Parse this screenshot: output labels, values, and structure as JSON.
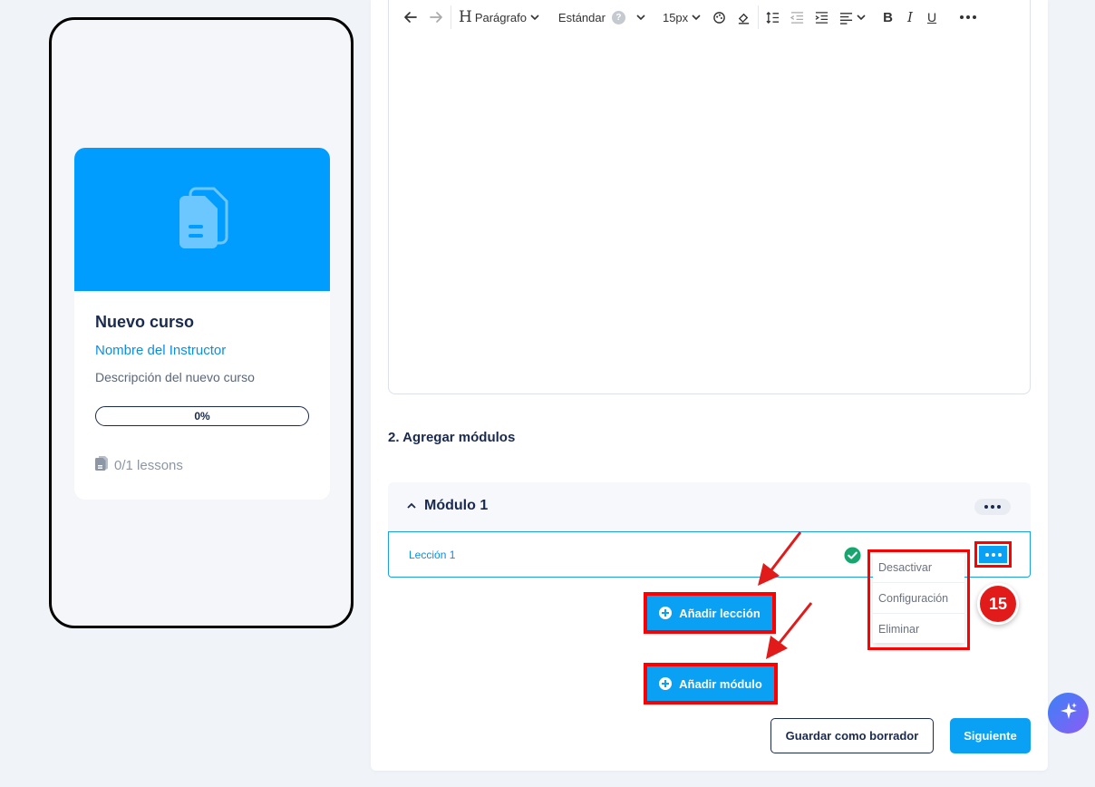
{
  "preview": {
    "course_title": "Nuevo curso",
    "instructor": "Nombre del Instructor",
    "description": "Descripción del nuevo curso",
    "progress_label": "0%",
    "progress": 0,
    "lessons_label": "0/1 lessons",
    "banner_icon": "documents-icon"
  },
  "toolbar": {
    "heading_label": "Parágrafo",
    "style_label": "Estándar",
    "help_label": "?",
    "font_size": "15px"
  },
  "builder": {
    "section_title": "2. Agregar módulos",
    "module_title": "Módulo 1",
    "lesson_title": "Lección 1",
    "menu_items": [
      "Desactivar",
      "Configuración",
      "Eliminar"
    ],
    "step_number": "15",
    "add_lesson_label": "Añadir lección",
    "add_module_label": "Añadir módulo",
    "save_draft_label": "Guardar como borrador",
    "next_label": "Siguiente"
  },
  "colors": {
    "accent": "#0aa0f4",
    "annotation": "#ff0000",
    "success": "#1aa570",
    "text_dark": "#1a2a4e"
  }
}
